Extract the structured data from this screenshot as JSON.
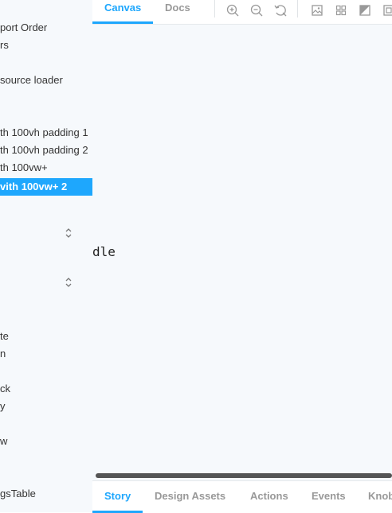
{
  "sidebar": {
    "items": [
      {
        "label": "port Order"
      },
      {
        "label": "rs"
      },
      {
        "label": " source loader"
      },
      {
        "label": "th 100vh padding 1"
      },
      {
        "label": "th 100vh padding 2"
      },
      {
        "label": "th 100vw+"
      },
      {
        "label": "vith 100vw+ 2",
        "selected": true
      },
      {
        "label": "te"
      },
      {
        "label": "n"
      },
      {
        "label": "ck"
      },
      {
        "label": "y"
      },
      {
        "label": "w"
      },
      {
        "label": "gsTable"
      }
    ],
    "selected_bg": "#1ea7fd"
  },
  "toolbar": {
    "tabs": [
      {
        "label": "Canvas",
        "active": true
      },
      {
        "label": "Docs",
        "active": false
      }
    ],
    "tools": [
      "zoom-in-icon",
      "zoom-out-icon",
      "reset-zoom-icon",
      "background-icon",
      "grid-icon",
      "contrast-icon",
      "outline-icon"
    ]
  },
  "stage": {
    "text": "dle"
  },
  "addons": {
    "tabs": [
      {
        "label": "Story",
        "active": true
      },
      {
        "label": "Design Assets",
        "active": false
      },
      {
        "label": "Actions",
        "active": false
      },
      {
        "label": "Events",
        "active": false
      },
      {
        "label": "Knob",
        "active": false
      }
    ]
  },
  "colors": {
    "accent": "#1ea7fd",
    "sidebar_bg": "#f6f9fc",
    "text": "#333333",
    "muted": "#999999"
  }
}
